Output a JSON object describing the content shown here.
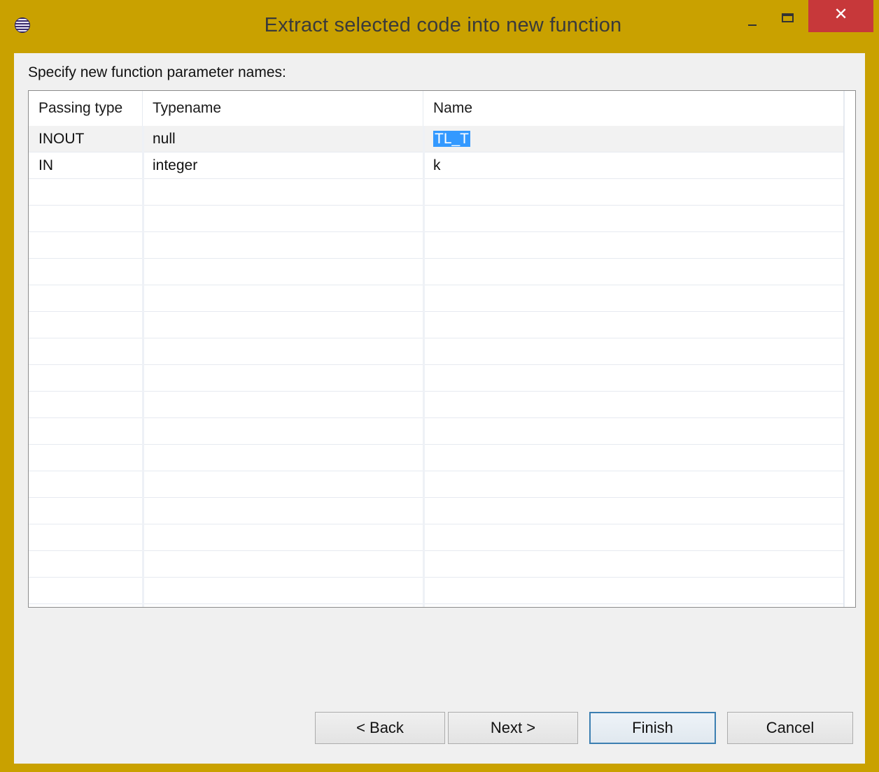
{
  "window": {
    "title": "Extract selected code into new function",
    "close_glyph": "✕",
    "icons": {
      "app": "eclipse-icon",
      "minimize": "minimize-icon",
      "maximize": "maximize-icon",
      "close": "close-icon"
    },
    "accent_color": "#c9a100",
    "close_color": "#c7383a"
  },
  "dialog": {
    "prompt": "Specify new function parameter names:",
    "table": {
      "headers": [
        "Passing type",
        "Typename",
        "Name"
      ],
      "rows": [
        {
          "passing_type": "INOUT",
          "typename": "null",
          "name": "TL_T",
          "selected": true
        },
        {
          "passing_type": "IN",
          "typename": "integer",
          "name": "k",
          "selected": false
        }
      ],
      "selection_color": "#3399ff"
    },
    "buttons": {
      "back": "< Back",
      "next": "Next >",
      "finish": "Finish",
      "cancel": "Cancel"
    }
  }
}
